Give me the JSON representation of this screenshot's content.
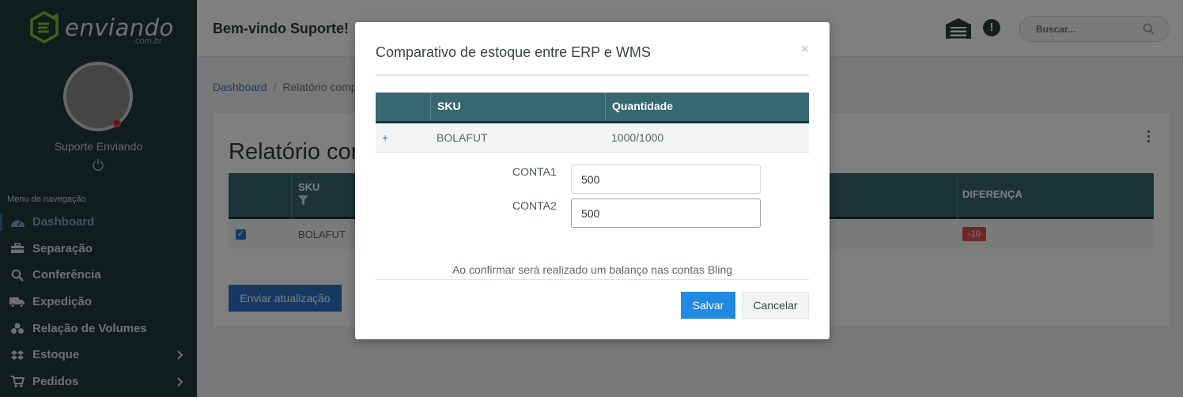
{
  "app": {
    "logo_text": "enviando",
    "logo_sub": ".com.br",
    "brand_color": "#8bbf3c"
  },
  "sidebar": {
    "user_name": "Suporte Enviando",
    "nav_title": "Menu de navegação",
    "items": [
      {
        "label": "Dashboard",
        "icon": "dashboard-gauge-icon",
        "active": true
      },
      {
        "label": "Separação",
        "icon": "toolbox-icon"
      },
      {
        "label": "Conferência",
        "icon": "search-icon"
      },
      {
        "label": "Expedição",
        "icon": "truck-icon"
      },
      {
        "label": "Relação de Volumes",
        "icon": "boxes-icon"
      },
      {
        "label": "Estoque",
        "icon": "dropbox-icon",
        "has_submenu": true
      },
      {
        "label": "Pedidos",
        "icon": "cart-icon",
        "has_submenu": true
      }
    ]
  },
  "header": {
    "welcome": "Bem-vindo Suporte!",
    "search_placeholder": "Buscar..."
  },
  "breadcrumb": {
    "home": "Dashboard",
    "separator": "/",
    "current": "Relatório comp"
  },
  "report": {
    "title": "Relatório com",
    "columns": {
      "sku": "SKU",
      "diferenca": "DIFERENÇA"
    },
    "row": {
      "sku": "BOLAFUT",
      "diferenca": "-10",
      "checked": true
    },
    "send_button": "Enviar atualização"
  },
  "modal": {
    "title": "Comparativo de estoque entre ERP e WMS",
    "close": "×",
    "table": {
      "headers": [
        "",
        "SKU",
        "Quantidade"
      ],
      "row": {
        "expand": "+",
        "sku": "BOLAFUT",
        "quantidade": "1000/1000"
      }
    },
    "fields": [
      {
        "label": "CONTA1",
        "value": "500"
      },
      {
        "label": "CONTA2",
        "value": "500"
      }
    ],
    "note": "Ao confirmar será realizado um balanço nas contas Bling",
    "save_button": "Salvar",
    "cancel_button": "Cancelar"
  }
}
